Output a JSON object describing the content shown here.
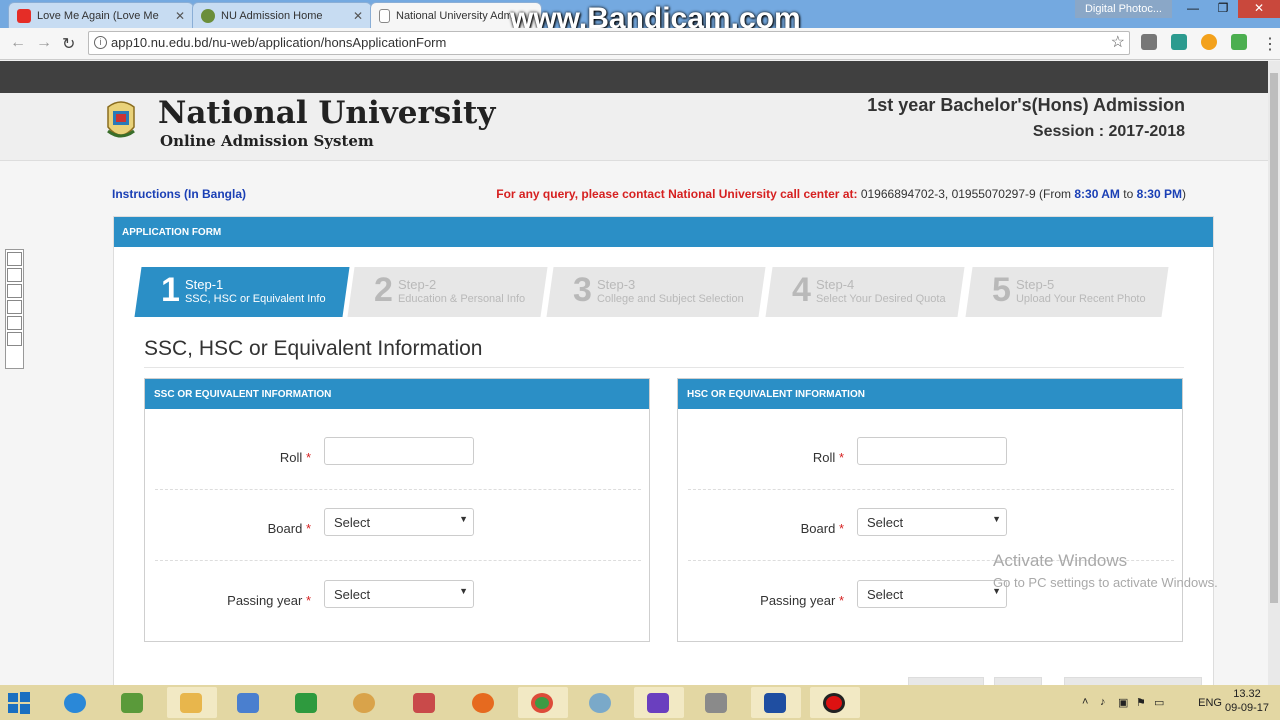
{
  "browser": {
    "tabs": [
      {
        "label": "Love Me Again (Love Me",
        "icon": "youtube-icon"
      },
      {
        "label": "NU Admission Home",
        "icon": "nu-logo-icon"
      },
      {
        "label": "National University Adm",
        "icon": "page-icon"
      }
    ],
    "watermark": "www.Bandicam.com",
    "app_label": "Digital Photoc...",
    "url": "app10.nu.edu.bd/nu-web/application/honsApplicationForm"
  },
  "header": {
    "university": "National University",
    "subtitle": "Online Admission System",
    "admission_title": "1st year Bachelor's(Hons) Admission",
    "session": "Session : 2017-2018"
  },
  "info": {
    "instructions": "Instructions (In Bangla)",
    "query_prefix": "For any query, please contact National University call center at:",
    "phones": "01966894702-3, 01955070297-9",
    "from_label": "(From",
    "from_time": "8:30 AM",
    "to_label": "to",
    "to_time": "8:30 PM",
    "close_paren": ")"
  },
  "form": {
    "panel_title": "APPLICATION FORM",
    "steps": [
      {
        "num": "1",
        "title": "Step-1",
        "desc": "SSC, HSC or Equivalent Info",
        "active": true
      },
      {
        "num": "2",
        "title": "Step-2",
        "desc": "Education & Personal Info",
        "active": false
      },
      {
        "num": "3",
        "title": "Step-3",
        "desc": "College and Subject Selection",
        "active": false
      },
      {
        "num": "4",
        "title": "Step-4",
        "desc": "Select Your Desired Quota",
        "active": false
      },
      {
        "num": "5",
        "title": "Step-5",
        "desc": "Upload Your Recent Photo",
        "active": false
      }
    ],
    "section_title": "SSC, HSC or Equivalent Information",
    "ssc": {
      "title": "SSC OR EQUIVALENT INFORMATION",
      "roll_label": "Roll",
      "roll_value": "",
      "board_label": "Board",
      "board_value": "Select",
      "year_label": "Passing year",
      "year_value": "Select"
    },
    "hsc": {
      "title": "HSC OR EQUIVALENT INFORMATION",
      "roll_label": "Roll",
      "roll_value": "",
      "board_label": "Board",
      "board_value": "Select",
      "year_label": "Passing year",
      "year_value": "Select"
    },
    "required_mark": "*"
  },
  "overlay": {
    "activate_line1": "Activate Windows",
    "activate_line2": "Go to PC settings to activate Windows."
  },
  "taskbar": {
    "lang": "ENG",
    "time": "13.32",
    "date": "09-09-17"
  }
}
